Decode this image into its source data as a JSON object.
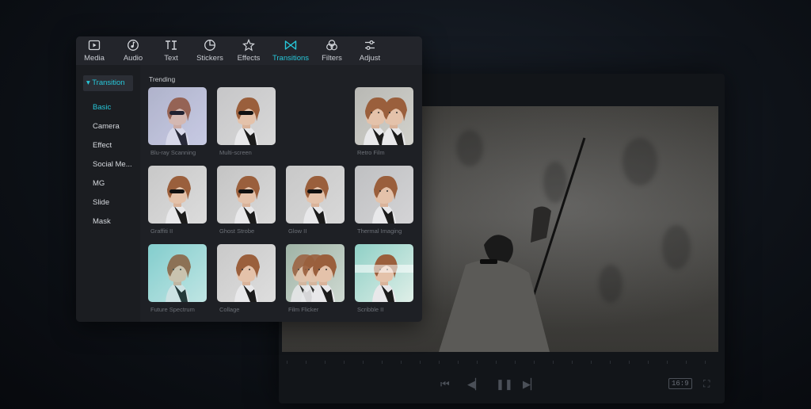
{
  "toolbar": {
    "items": [
      {
        "label": "Media",
        "icon": "play-square-icon"
      },
      {
        "label": "Audio",
        "icon": "music-note-icon"
      },
      {
        "label": "Text",
        "icon": "text-ti-icon"
      },
      {
        "label": "Stickers",
        "icon": "sticker-icon"
      },
      {
        "label": "Effects",
        "icon": "sparkle-star-icon"
      },
      {
        "label": "Transitions",
        "icon": "bowtie-icon"
      },
      {
        "label": "Filters",
        "icon": "three-circles-icon"
      },
      {
        "label": "Adjust",
        "icon": "sliders-icon"
      }
    ],
    "active": "Transitions"
  },
  "sidebar": {
    "header": "▾ Transition",
    "items": [
      "Basic",
      "Camera",
      "Effect",
      "Social Me...",
      "MG",
      "Slide",
      "Mask"
    ],
    "active": "Basic"
  },
  "content": {
    "section_title": "Trending",
    "tiles": [
      {
        "label": "Blu-ray Scanning"
      },
      {
        "label": "Multi-screen"
      },
      {
        "label": "Retro Film"
      },
      {
        "label": "Graffiti II"
      },
      {
        "label": "Ghost Strobe"
      },
      {
        "label": "Glow II"
      },
      {
        "label": "Thermal Imaging"
      },
      {
        "label": "Future Spectrum"
      },
      {
        "label": "Collage"
      },
      {
        "label": "Film Flicker"
      },
      {
        "label": "Scribble II"
      }
    ]
  },
  "player": {
    "aspect_ratio": "16:9"
  },
  "colors": {
    "accent": "#27c7d9",
    "panel_bg": "#1e2025",
    "sidebar_bg": "#1b1d21"
  }
}
